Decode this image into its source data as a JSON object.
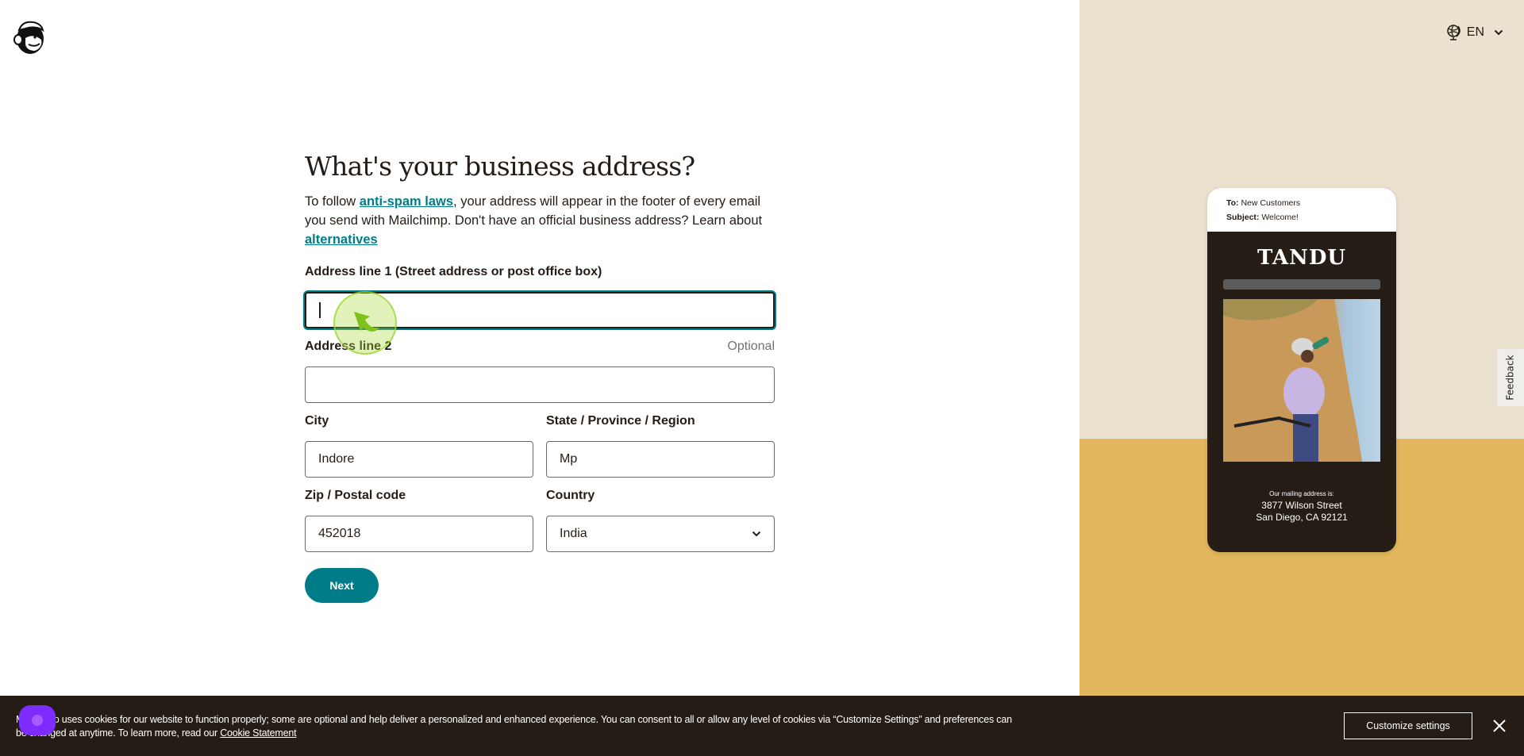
{
  "app": {
    "brand": "Mailchimp"
  },
  "header": {
    "language": {
      "icon": "globe-icon",
      "label": "EN",
      "chevron": "chevron-down-icon"
    }
  },
  "form": {
    "title": "What's your business address?",
    "intro": {
      "before_link": "To follow ",
      "link1": "anti-spam laws",
      "middle": ", your address will appear in the footer of every email you send with Mailchimp. Don't have an official business address? Learn about ",
      "link2": "alternatives"
    },
    "fields": {
      "address1": {
        "label": "Address line 1 (Street address or post office box)",
        "value": ""
      },
      "address2": {
        "label": "Address line 2",
        "hint": "Optional",
        "value": ""
      },
      "city": {
        "label": "City",
        "value": "Indore"
      },
      "state": {
        "label": "State / Province / Region",
        "value": "Mp"
      },
      "zip": {
        "label": "Zip / Postal code",
        "value": "452018"
      },
      "country": {
        "label": "Country",
        "value": "India"
      }
    },
    "next_label": "Next"
  },
  "promo": {
    "to_label": "To:",
    "to_value": " New Customers",
    "subject_label": "Subject:",
    "subject_value": " Welcome!",
    "brand_name": "TANDU",
    "mailing_label": "Our mailing address is:",
    "address_line1": "3877 Wilson Street",
    "address_line2": "San Diego, CA 92121"
  },
  "feedback": {
    "label": "Feedback"
  },
  "cookie_banner": {
    "text_line": "Mailchimp uses cookies for our website to function properly; some are optional and help deliver a personalized and enhanced experience. You can consent to all or allow any level of cookies via “Customize Settings” and preferences can be changed at anytime. To learn more, read our ",
    "link": "Cookie Statement",
    "customize_label": "Customize settings",
    "close_icon": "close-icon"
  },
  "colors": {
    "accent": "#007c89",
    "text": "#241c15",
    "promo_top": "#ebe1cf",
    "promo_bottom": "#e2b75d",
    "banner": "#241c15"
  }
}
